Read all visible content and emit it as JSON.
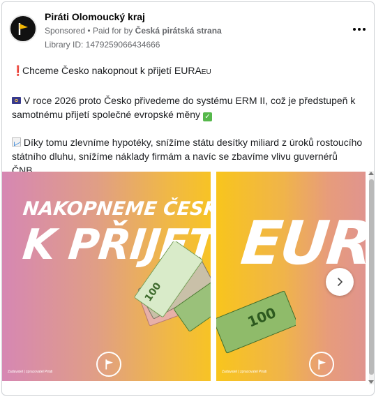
{
  "page": {
    "name": "Piráti Olomoucký kraj",
    "sponsored": "Sponsored",
    "separator": "•",
    "paid_for_prefix": "Paid for by",
    "payer": "Česká pirátská strana",
    "library_id": "Library ID: 1479259066434666"
  },
  "post": {
    "p1_text": "Chceme Česko nakopnout k přijetí EURA",
    "p1_suffix": "EU",
    "p2_text": "V roce 2026 proto Česko přivedeme do systému ERM II, což je předstupeň k samotnému přijetí společné evropské měny",
    "p3_text": "Díky tomu zlevníme hypotéky, snížíme státu desítky miliard z úroků rostoucího státního dluhu, snížíme náklady firmám a navíc se zbavíme vlivu guvernérů ČNB…"
  },
  "carousel": {
    "card1": {
      "line1": "NAKOPNEME ČESKO",
      "line2": "K PŘIJETÍ",
      "disclaimer": "Zadavatel | zpracovatel Piráti"
    },
    "card2": {
      "headline": "EURA",
      "disclaimer": "Zadavatel | zpracovatel Piráti"
    }
  },
  "icons": {
    "exclamation": "red-exclamation-icon",
    "eu_flag": "eu-flag-icon",
    "check": "check-mark-icon",
    "chart": "chart-increasing-icon",
    "more": "more-options-icon",
    "next": "chevron-right-icon",
    "logo": "pirate-party-logo"
  },
  "colors": {
    "text": "#1c1e21",
    "muted": "#65676b",
    "card_pink": "#d687b3",
    "card_yellow": "#f7c325"
  }
}
